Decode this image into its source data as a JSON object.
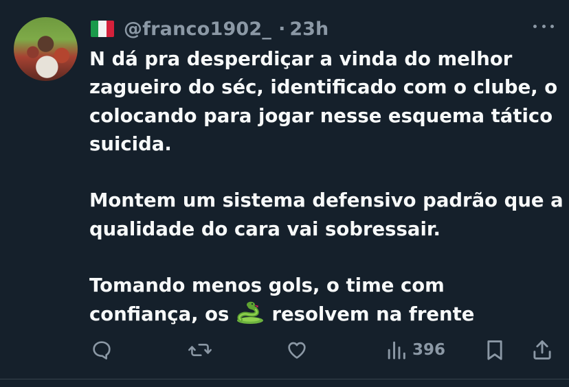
{
  "post": {
    "author_handle": "@franco1902_",
    "separator": "·",
    "time_ago": "23h",
    "flag_icon": "italy-flag-icon",
    "paragraphs": [
      {
        "lines": [
          "N dá pra desperdiçar a vinda do melhor",
          "zagueiro do séc, identificado com o clube, o",
          "colocando para jogar nesse esquema tático",
          "suicida."
        ]
      },
      {
        "lines": [
          "Montem um sistema defensivo padrão que a",
          "qualidade do cara vai sobressair."
        ]
      },
      {
        "lines": [
          "Tomando menos gols, o time com"
        ],
        "last_before_emoji": "confiança, os",
        "emoji": "snake-emoji",
        "last_after_emoji": "resolvem na frente"
      }
    ]
  },
  "actions": {
    "reply_icon": "reply-icon",
    "retweet_icon": "retweet-icon",
    "like_icon": "heart-icon",
    "views_icon": "views-chart-icon",
    "views_count": "396",
    "bookmark_icon": "bookmark-icon",
    "share_icon": "share-icon"
  },
  "colors": {
    "background": "#15202b",
    "text_primary": "#f7f9f9",
    "text_secondary": "#8b98a5",
    "divider": "#38444d"
  }
}
